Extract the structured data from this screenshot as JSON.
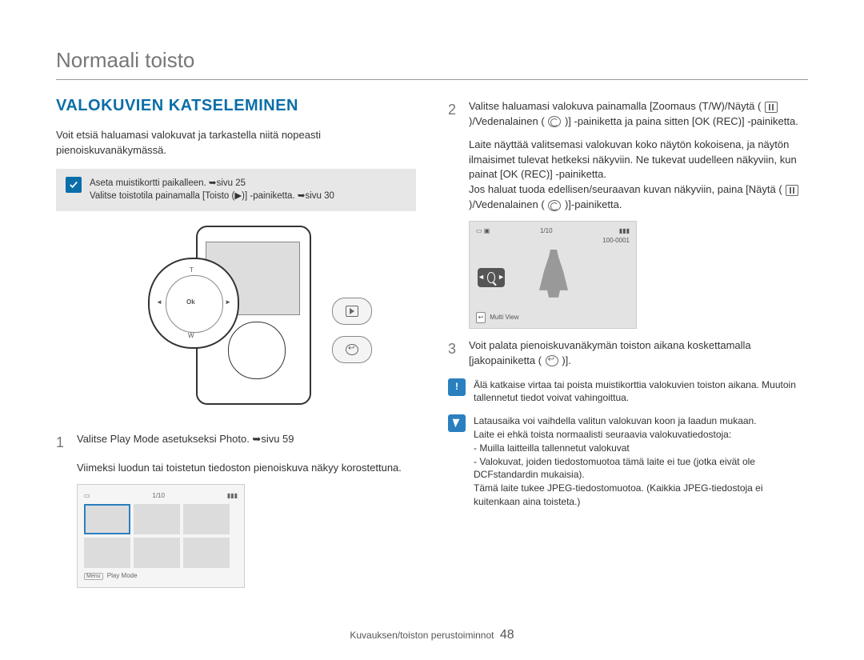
{
  "page_title": "Normaali toisto",
  "section_heading": "VALOKUVIEN KATSELEMINEN",
  "intro": "Voit etsiä haluamasi valokuvat ja tarkastella niitä nopeasti pienoiskuvanäkymässä.",
  "setup": {
    "line1": "Aseta muistikortti paikalleen. ➥sivu 25",
    "line2": "Valitse toistotila painamalla [Toisto (▶)] -painiketta. ➥sivu 30"
  },
  "device": {
    "dpad": {
      "top": "T",
      "bottom": "W",
      "center": "Ok",
      "left": "◄",
      "right": "►"
    }
  },
  "steps": {
    "s1_a": "Valitse Play Mode asetukseksi Photo. ➥sivu 59",
    "s1_b": "Viimeksi luodun tai toistetun tiedoston pienoiskuva näkyy korostettuna.",
    "s2_a": "Valitse haluamasi valokuva painamalla [Zoomaus (T/W)/Näytä (",
    "s2_b": ")/Vedenalainen (",
    "s2_c": ")] -painiketta ja paina sitten [OK (REC)] -painiketta.",
    "s2_d": "Laite näyttää valitsemasi valokuvan koko näytön kokoisena, ja näytön ilmaisimet tulevat hetkeksi näkyviin. Ne tukevat uudelleen näkyviin, kun painat [OK (REC)] -painiketta.",
    "s2_e": "Jos haluat tuoda edellisen/seuraavan kuvan näkyviin, paina [Näytä (",
    "s2_f": ")/Vedenalainen (",
    "s2_g": ")]-painiketta.",
    "s3_a": "Voit palata pienoiskuvanäkymän toiston aikana koskettamalla [jakopainiketta (",
    "s3_b": ")]."
  },
  "thumb_screen": {
    "counter": "1/10",
    "footer_menu": "Menu",
    "footer_label": "Play Mode"
  },
  "single_screen": {
    "counter": "1/10",
    "file_no": "100-0001",
    "multi_view": "Multi View"
  },
  "warn": "Älä katkaise virtaa tai poista muistikorttia valokuvien toiston aikana. Muutoin tallennetut tiedot voivat vahingoittua.",
  "note": {
    "l1": "Latausaika voi vaihdella valitun valokuvan koon ja laadun mukaan.",
    "l2": "Laite ei ehkä toista normaalisti seuraavia valokuvatiedostoja:",
    "l3": "- Muilla laitteilla tallennetut valokuvat",
    "l4": "- Valokuvat, joiden tiedostomuotoa tämä laite ei tue (jotka eivät ole DCFstandardin mukaisia).",
    "l5": "Tämä laite tukee JPEG-tiedostomuotoa. (Kaikkia JPEG-tiedostoja ei kuitenkaan aina toisteta.)"
  },
  "footer": {
    "section": "Kuvauksen/toiston perustoiminnot",
    "page": "48"
  }
}
